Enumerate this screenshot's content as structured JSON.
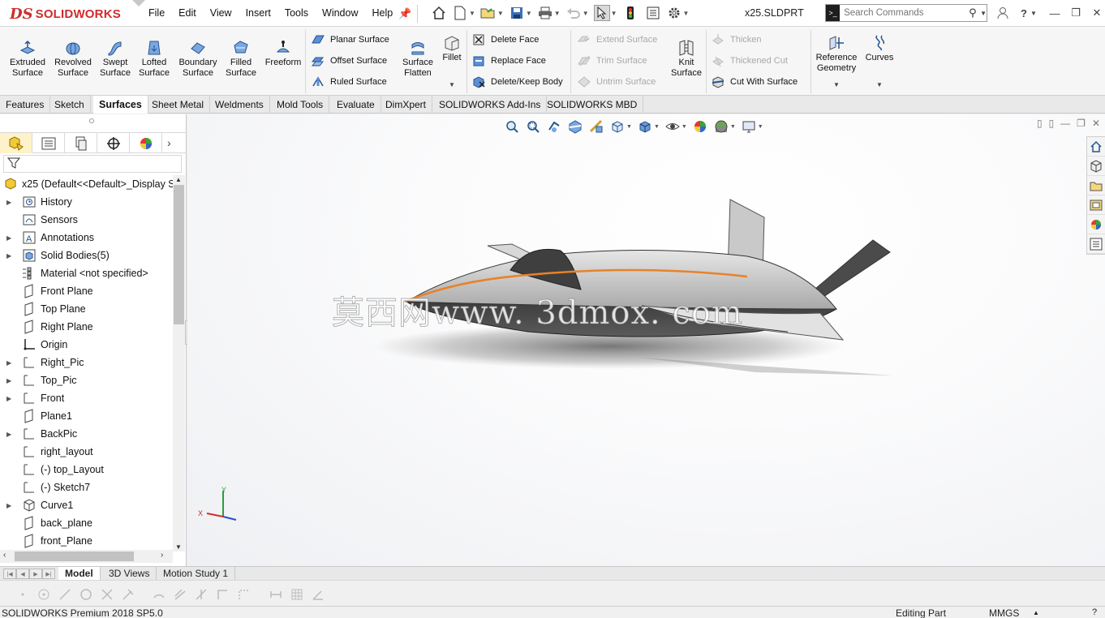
{
  "app": {
    "logo_ds": "DS",
    "logo_name": "SOLIDWORKS",
    "doc_title": "x25.SLDPRT",
    "menus": [
      "File",
      "Edit",
      "View",
      "Insert",
      "Tools",
      "Window",
      "Help"
    ]
  },
  "search": {
    "placeholder": "Search Commands"
  },
  "command_manager": {
    "surface_buttons": [
      {
        "label": "Extruded\nSurface",
        "icon": "extruded-surface-icon"
      },
      {
        "label": "Revolved\nSurface",
        "icon": "revolved-surface-icon"
      },
      {
        "label": "Swept\nSurface",
        "icon": "swept-surface-icon"
      },
      {
        "label": "Lofted\nSurface",
        "icon": "lofted-surface-icon"
      },
      {
        "label": "Boundary\nSurface",
        "icon": "boundary-surface-icon"
      },
      {
        "label": "Filled\nSurface",
        "icon": "filled-surface-icon"
      },
      {
        "label": "Freeform",
        "icon": "freeform-icon"
      }
    ],
    "planar_group": [
      "Planar Surface",
      "Offset Surface",
      "Ruled Surface"
    ],
    "surface_flatten": "Surface\nFlatten",
    "fillet": "Fillet",
    "face_group": [
      "Delete Face",
      "Replace Face",
      "Delete/Keep Body"
    ],
    "extend_group": [
      "Extend Surface",
      "Trim Surface",
      "Untrim Surface"
    ],
    "knit": "Knit\nSurface",
    "thicken_group": [
      "Thicken",
      "Thickened Cut",
      "Cut With Surface"
    ],
    "reference_geometry": "Reference\nGeometry",
    "curves": "Curves"
  },
  "tabs": [
    "Features",
    "Sketch",
    "Surfaces",
    "Sheet Metal",
    "Weldments",
    "Mold Tools",
    "Evaluate",
    "DimXpert",
    "SOLIDWORKS Add-Ins",
    "SOLIDWORKS MBD"
  ],
  "active_tab": "Surfaces",
  "feature_tree": {
    "root": "x25  (Default<<Default>_Display St",
    "items": [
      {
        "label": "History",
        "icon": "history-icon",
        "expandable": true
      },
      {
        "label": "Sensors",
        "icon": "sensors-icon",
        "expandable": false
      },
      {
        "label": "Annotations",
        "icon": "annotations-icon",
        "expandable": true
      },
      {
        "label": "Solid Bodies(5)",
        "icon": "solid-bodies-icon",
        "expandable": true
      },
      {
        "label": "Material <not specified>",
        "icon": "material-icon",
        "expandable": false
      },
      {
        "label": "Front Plane",
        "icon": "plane-icon",
        "expandable": false
      },
      {
        "label": "Top Plane",
        "icon": "plane-icon",
        "expandable": false
      },
      {
        "label": "Right Plane",
        "icon": "plane-icon",
        "expandable": false
      },
      {
        "label": "Origin",
        "icon": "origin-icon",
        "expandable": false
      },
      {
        "label": "Right_Pic",
        "icon": "sketch-icon",
        "expandable": true
      },
      {
        "label": "Top_Pic",
        "icon": "sketch-icon",
        "expandable": true
      },
      {
        "label": "Front",
        "icon": "sketch-icon",
        "expandable": true
      },
      {
        "label": "Plane1",
        "icon": "plane-icon",
        "expandable": false
      },
      {
        "label": "BackPic",
        "icon": "sketch-icon",
        "expandable": true
      },
      {
        "label": "right_layout",
        "icon": "sketch-icon",
        "expandable": false
      },
      {
        "label": "(-) top_Layout",
        "icon": "sketch-icon",
        "expandable": false
      },
      {
        "label": "(-) Sketch7",
        "icon": "sketch-icon",
        "expandable": false
      },
      {
        "label": "Curve1",
        "icon": "curve-icon",
        "expandable": true
      },
      {
        "label": "back_plane",
        "icon": "plane-icon",
        "expandable": false
      },
      {
        "label": "front_Plane",
        "icon": "plane-icon",
        "expandable": false
      }
    ]
  },
  "viewport": {
    "watermark": "莫西网www. 3dmox. com",
    "triad_x": "X",
    "triad_y": "Y"
  },
  "bottom_tabs": [
    "Model",
    "3D Views",
    "Motion Study 1"
  ],
  "active_bottom_tab": "Model",
  "status": {
    "product": "SOLIDWORKS Premium 2018 SP5.0",
    "mode": "Editing Part",
    "units": "MMGS"
  },
  "colors": {
    "brand_red": "#d12c2c",
    "accent_blue": "#2a6fcf",
    "active_pane_tab": "#fdf2c9",
    "model_curve_orange": "#e8822a"
  }
}
